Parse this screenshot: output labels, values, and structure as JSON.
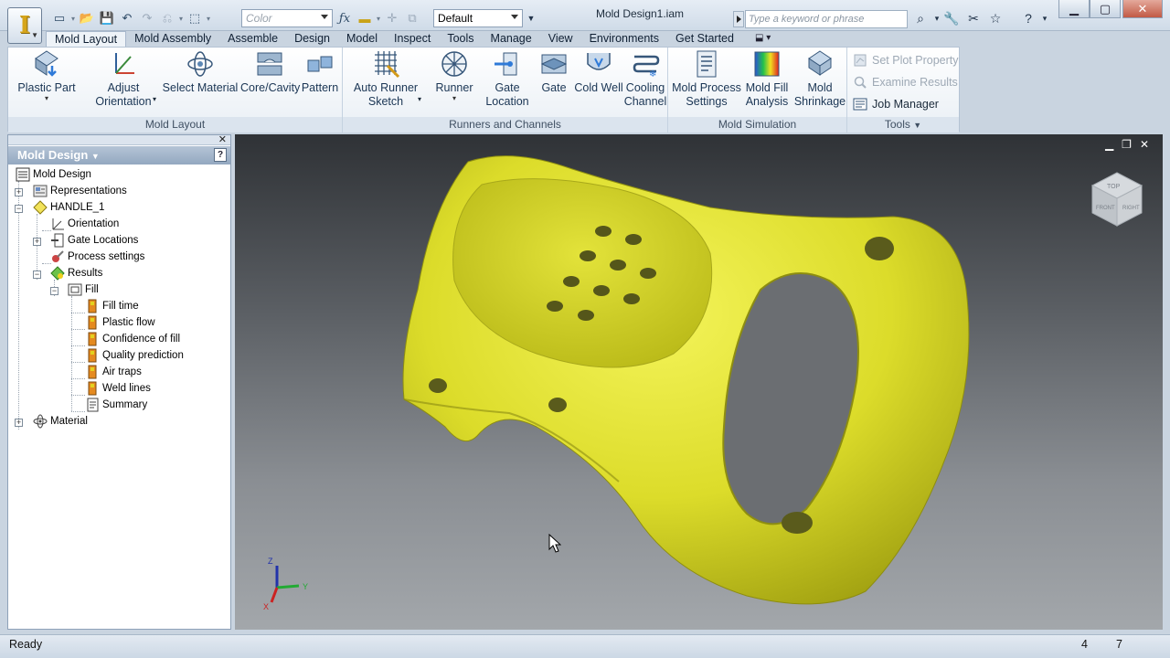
{
  "window": {
    "title": "Mold Design1.iam"
  },
  "quick_access": {
    "color_placeholder": "Color",
    "style_value": "Default"
  },
  "search": {
    "placeholder": "Type a keyword or phrase"
  },
  "tabs": [
    {
      "label": "Mold Layout",
      "active": true
    },
    {
      "label": "Mold Assembly"
    },
    {
      "label": "Assemble"
    },
    {
      "label": "Design"
    },
    {
      "label": "Model"
    },
    {
      "label": "Inspect"
    },
    {
      "label": "Tools"
    },
    {
      "label": "Manage"
    },
    {
      "label": "View"
    },
    {
      "label": "Environments"
    },
    {
      "label": "Get Started"
    }
  ],
  "ribbon": {
    "mold_layout": {
      "title": "Mold Layout",
      "plastic_part": "Plastic Part",
      "adjust_orientation_1": "Adjust",
      "adjust_orientation_2": "Orientation",
      "select_material": "Select Material",
      "core_cavity": "Core/Cavity",
      "pattern": "Pattern"
    },
    "runners": {
      "title": "Runners and Channels",
      "auto_runner_1": "Auto Runner",
      "auto_runner_2": "Sketch",
      "runner": "Runner",
      "gate_location_1": "Gate",
      "gate_location_2": "Location",
      "gate": "Gate",
      "cold_well": "Cold Well",
      "cooling_channel_1": "Cooling",
      "cooling_channel_2": "Channel"
    },
    "simulation": {
      "title": "Mold Simulation",
      "process_settings_1": "Mold Process",
      "process_settings_2": "Settings",
      "fill_analysis_1": "Mold Fill",
      "fill_analysis_2": "Analysis",
      "shrinkage_1": "Mold",
      "shrinkage_2": "Shrinkage"
    },
    "tools": {
      "title": "Tools",
      "set_plot_property": "Set Plot Property",
      "examine_results": "Examine Results",
      "job_manager": "Job Manager"
    }
  },
  "browser": {
    "title": "Mold Design",
    "tree": {
      "root": "Mold Design",
      "representations": "Representations",
      "handle": "HANDLE_1",
      "orientation": "Orientation",
      "gate_locations": "Gate Locations",
      "process_settings": "Process settings",
      "results": "Results",
      "fill": "Fill",
      "fill_time": "Fill time",
      "plastic_flow": "Plastic flow",
      "confidence_of_fill": "Confidence of fill",
      "quality_prediction": "Quality prediction",
      "air_traps": "Air traps",
      "weld_lines": "Weld lines",
      "summary": "Summary",
      "material": "Material"
    }
  },
  "viewcube": {
    "face_top": "TOP",
    "face_front": "FRONT",
    "face_right": "RIGHT"
  },
  "triad": {
    "x": "X",
    "y": "Y",
    "z": "Z"
  },
  "status": {
    "text": "Ready",
    "n1": "4",
    "n2": "7"
  },
  "colors": {
    "part_yellow": "#e4e32a",
    "ribbon_bg": "#eef3f8",
    "accent": "#1a3554"
  }
}
